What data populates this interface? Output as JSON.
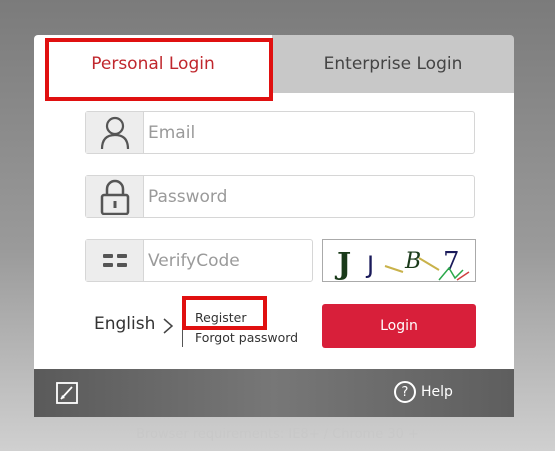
{
  "tabs": {
    "personal": "Personal Login",
    "enterprise": "Enterprise Login"
  },
  "fields": {
    "email": {
      "placeholder": "Email",
      "icon": "user-icon"
    },
    "password": {
      "placeholder": "Password",
      "icon": "lock-icon"
    },
    "verify": {
      "placeholder": "VerifyCode",
      "icon": "keypad-icon"
    }
  },
  "captcha": {
    "text": "JJ B7"
  },
  "language": {
    "label": "English"
  },
  "links": {
    "register": "Register",
    "forgot": "Forgot password"
  },
  "login_button": "Login",
  "footer": {
    "help": "Help",
    "help_symbol": "?",
    "edit_icon": "edit-icon"
  },
  "requirements": "Browser requirements: IE8+ / Chrome 30 +",
  "colors": {
    "accent": "#d81f3a",
    "tab_text": "#c0272d",
    "highlight": "#e01010"
  }
}
